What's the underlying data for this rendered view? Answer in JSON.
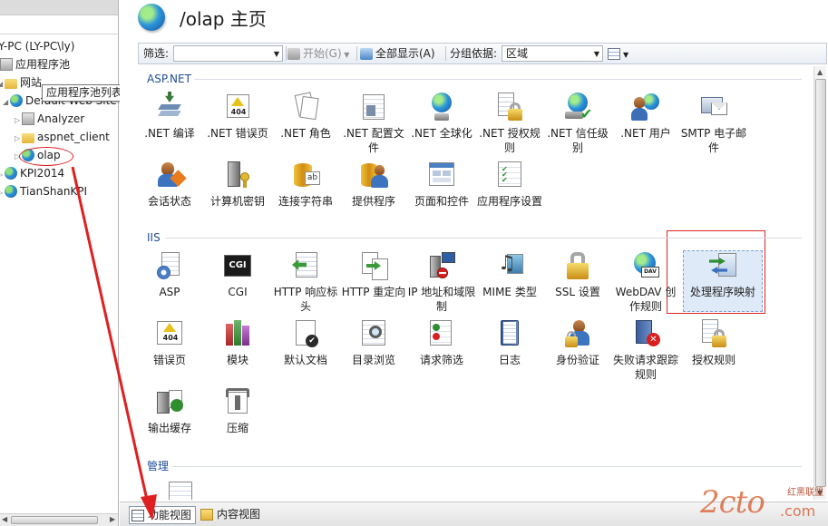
{
  "tree": {
    "server": "Y-PC (LY-PC\\ly)",
    "app_pools": "应用程序池",
    "sites": "网站",
    "default_site": "Default Web Site",
    "children": [
      "Analyzer",
      "aspnet_client",
      "olap"
    ],
    "kpi": "KPI2014",
    "tianshan": "TianShanKPI",
    "tooltip": "应用程序池列表"
  },
  "header": {
    "title": "/olap 主页"
  },
  "toolbar": {
    "filter_label": "筛选:",
    "start_label": "开始(G)",
    "show_all_label": "全部显示(A)",
    "group_by_label": "分组依据:",
    "group_by_value": "区域"
  },
  "sections": [
    {
      "title": "ASP.NET",
      "items": [
        ".NET 编译",
        ".NET 错误页",
        ".NET 角色",
        ".NET 配置文件",
        ".NET 全球化",
        ".NET 授权规则",
        ".NET 信任级别",
        ".NET 用户",
        "SMTP 电子邮件",
        "会话状态",
        "计算机密钥",
        "连接字符串",
        "提供程序",
        "页面和控件",
        "应用程序设置"
      ]
    },
    {
      "title": "IIS",
      "items": [
        "ASP",
        "CGI",
        "HTTP 响应标头",
        "HTTP 重定向",
        "IP 地址和域限制",
        "MIME 类型",
        "SSL 设置",
        "WebDAV 创作规则",
        "处理程序映射",
        "错误页",
        "模块",
        "默认文档",
        "目录浏览",
        "请求筛选",
        "日志",
        "身份验证",
        "失败请求跟踪规则",
        "授权规则",
        "输出缓存",
        "压缩"
      ]
    },
    {
      "title": "管理",
      "items": []
    }
  ],
  "icon_names": {
    "net_compile": "compile-icon",
    "net_error": "error-page-icon",
    "net_roles": "roles-icon",
    "cgi_text": "CGI",
    "error_text": "404"
  },
  "bottom": {
    "features_view": "功能视图",
    "content_view": "内容视图"
  },
  "watermark": {
    "main": "2cto",
    "sub": "红黑联盟",
    "domain": ".com"
  },
  "colors": {
    "section": "#1f4e96",
    "annotation": "#e02020",
    "selected": "#dfeaf8"
  }
}
